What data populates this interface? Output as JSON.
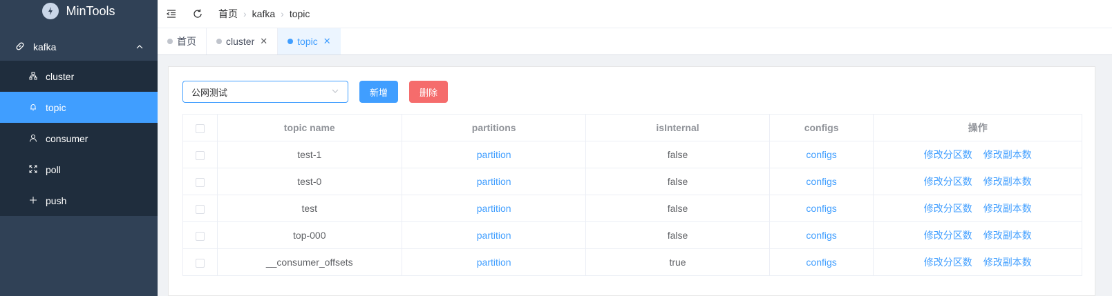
{
  "app": {
    "title": "MinTools"
  },
  "sidebar": {
    "group_label": "kafka",
    "items": [
      {
        "label": "cluster",
        "icon": "cluster-icon",
        "active": false
      },
      {
        "label": "topic",
        "icon": "bell-icon",
        "active": true
      },
      {
        "label": "consumer",
        "icon": "user-icon",
        "active": false
      },
      {
        "label": "poll",
        "icon": "expand-icon",
        "active": false
      },
      {
        "label": "push",
        "icon": "plus-icon",
        "active": false
      }
    ]
  },
  "header": {
    "breadcrumb": [
      "首页",
      "kafka",
      "topic"
    ]
  },
  "tags": [
    {
      "label": "首页",
      "closable": false,
      "active": false
    },
    {
      "label": "cluster",
      "closable": true,
      "active": false
    },
    {
      "label": "topic",
      "closable": true,
      "active": true
    }
  ],
  "toolbar": {
    "select_value": "公网测试",
    "add_label": "新增",
    "delete_label": "删除"
  },
  "table": {
    "headers": [
      "topic name",
      "partitions",
      "isInternal",
      "configs",
      "操作"
    ],
    "rows": [
      {
        "name": "test-1",
        "partitions": "partition",
        "isInternal": "false",
        "configs": "configs",
        "op1": "修改分区数",
        "op2": "修改副本数"
      },
      {
        "name": "test-0",
        "partitions": "partition",
        "isInternal": "false",
        "configs": "configs",
        "op1": "修改分区数",
        "op2": "修改副本数"
      },
      {
        "name": "test",
        "partitions": "partition",
        "isInternal": "false",
        "configs": "configs",
        "op1": "修改分区数",
        "op2": "修改副本数"
      },
      {
        "name": "top-000",
        "partitions": "partition",
        "isInternal": "false",
        "configs": "configs",
        "op1": "修改分区数",
        "op2": "修改副本数"
      },
      {
        "name": "__consumer_offsets",
        "partitions": "partition",
        "isInternal": "true",
        "configs": "configs",
        "op1": "修改分区数",
        "op2": "修改副本数"
      }
    ]
  },
  "colors": {
    "sidebar_bg": "#304156",
    "submenu_bg": "#1f2d3d",
    "accent": "#409eff",
    "danger": "#f56c6c"
  }
}
